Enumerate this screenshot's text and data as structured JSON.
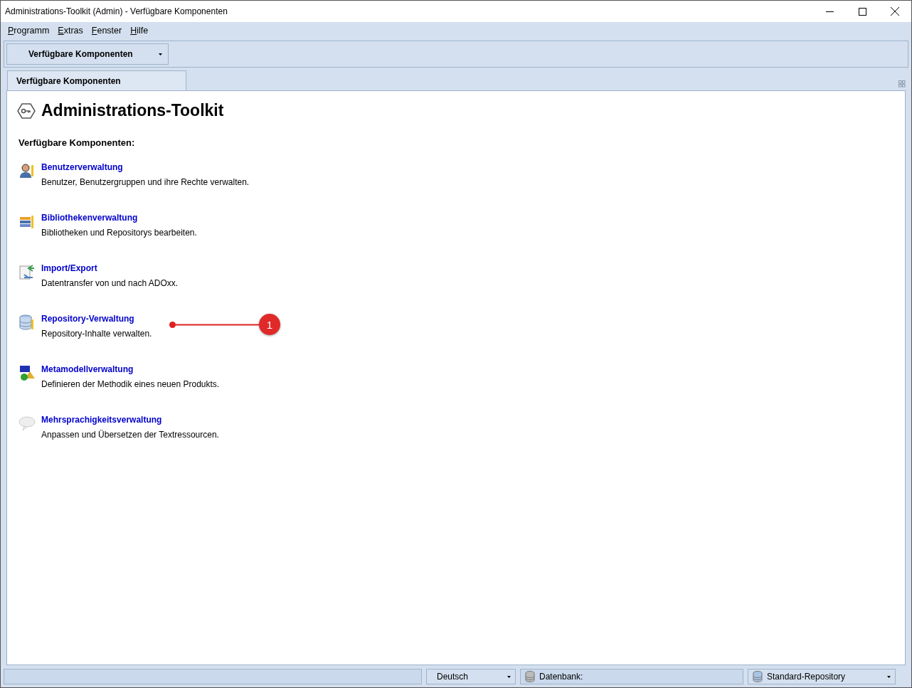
{
  "window": {
    "title": "Administrations-Toolkit (Admin) - Verfügbare Komponenten"
  },
  "menu": [
    "Programm",
    "Extras",
    "Fenster",
    "Hilfe"
  ],
  "toolbar": {
    "dropdown": "Verfügbare Komponenten"
  },
  "tabs": [
    {
      "label": "Verfügbare Komponenten",
      "selected": true
    }
  ],
  "page": {
    "heading": "Administrations-Toolkit",
    "subheading": "Verfügbare Komponenten:",
    "components": [
      {
        "kind": "users",
        "title": "Benutzerverwaltung",
        "description": "Benutzer, Benutzergruppen und ihre Rechte verwalten."
      },
      {
        "kind": "library",
        "title": "Bibliothekenverwaltung",
        "description": "Bibliotheken und Repositorys bearbeiten."
      },
      {
        "kind": "transfer",
        "title": "Import/Export",
        "description": "Datentransfer von und nach ADOxx."
      },
      {
        "kind": "repository",
        "title": "Repository-Verwaltung",
        "description": "Repository-Inhalte verwalten.",
        "callout": "1"
      },
      {
        "kind": "metamodel",
        "title": "Metamodellverwaltung",
        "description": "Definieren der Methodik eines neuen Produkts."
      },
      {
        "kind": "language",
        "title": "Mehrsprachigkeitsverwaltung",
        "description": "Anpassen und Übersetzen der Textressourcen."
      }
    ]
  },
  "status_bar": {
    "language": "Deutsch",
    "database": "Datenbank:",
    "repository": "Standard-Repository"
  }
}
